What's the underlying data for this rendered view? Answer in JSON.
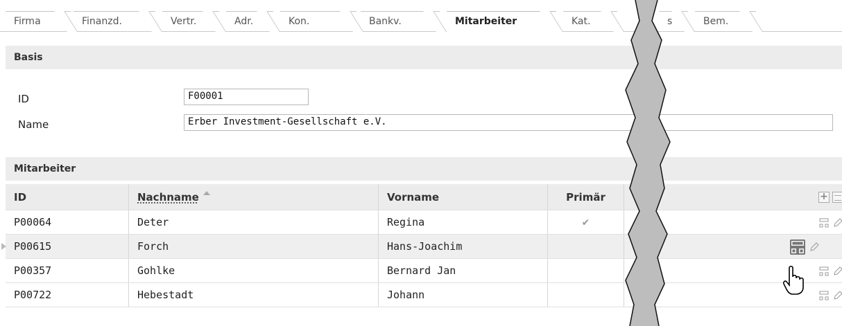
{
  "tabs": [
    {
      "label": "Firma",
      "active": false
    },
    {
      "label": "Finanzd.",
      "active": false
    },
    {
      "label": "Vertr.",
      "active": false
    },
    {
      "label": "Adr.",
      "active": false
    },
    {
      "label": "Kon.",
      "active": false
    },
    {
      "label": "Bankv.",
      "active": false
    },
    {
      "label": "Mitarbeiter",
      "active": true
    },
    {
      "label": "Kat.",
      "active": false
    },
    {
      "label": "s",
      "active": false
    },
    {
      "label": "Bem.",
      "active": false
    }
  ],
  "basis": {
    "title": "Basis",
    "id_label": "ID",
    "id_value": "F00001",
    "name_label": "Name",
    "name_value": "Erber Investment-Gesellschaft e.V."
  },
  "mitarbeiter": {
    "title": "Mitarbeiter",
    "columns": {
      "id": "ID",
      "nachname": "Nachname",
      "vorname": "Vorname",
      "primaer": "Primär"
    },
    "sort": {
      "column": "nachname",
      "direction": "asc"
    },
    "toolbar_icons": [
      "plus-icon",
      "table-icon"
    ],
    "rows": [
      {
        "id": "P00064",
        "nachname": "Deter",
        "vorname": "Regina",
        "primaer": "✔"
      },
      {
        "id": "P00615",
        "nachname": "Forch",
        "vorname": "Hans-Joachim",
        "primaer": ""
      },
      {
        "id": "P00357",
        "nachname": "Gohlke",
        "vorname": "Bernard Jan",
        "primaer": ""
      },
      {
        "id": "P00722",
        "nachname": "Hebestadt",
        "vorname": "Johann",
        "primaer": ""
      }
    ],
    "row_icons": [
      "org-icon",
      "edit-icon"
    ],
    "selected_row": 1
  },
  "colors": {
    "header_bg": "#ececec",
    "border": "#c4c4c4",
    "text": "#222222",
    "tear": "#bdbdbd"
  }
}
